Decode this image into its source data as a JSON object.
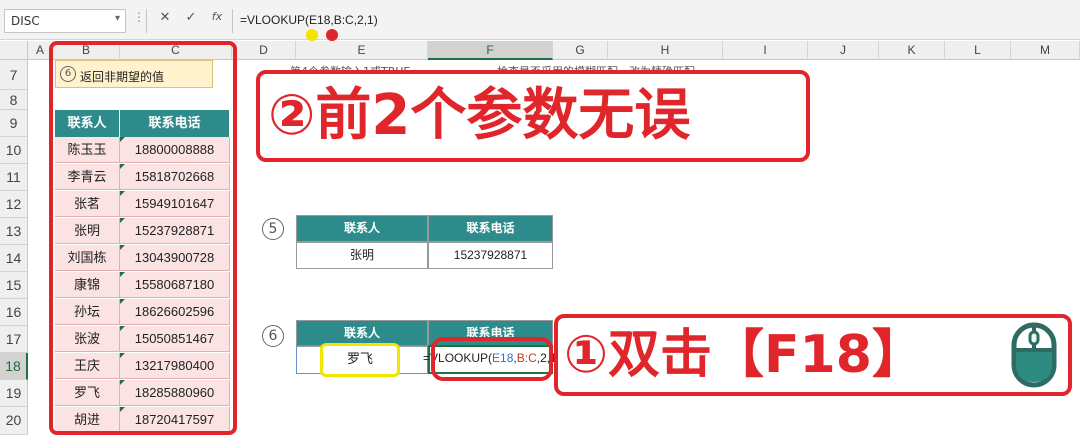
{
  "formula_bar": {
    "name_box": "DISC",
    "cancel_icon": "✕",
    "enter_icon": "✓",
    "function_icon": "fx",
    "formula": "=VLOOKUP(E18,B:C,2,1)"
  },
  "columns": [
    "A",
    "B",
    "C",
    "D",
    "E",
    "F",
    "G",
    "H",
    "I",
    "J",
    "K",
    "L",
    "M"
  ],
  "rows": [
    "7",
    "8",
    "9",
    "10",
    "11",
    "12",
    "13",
    "14",
    "15",
    "16",
    "17",
    "18",
    "19",
    "20"
  ],
  "note_row7": {
    "number": "6",
    "text": "返回非期望的值"
  },
  "left_table": {
    "headers": [
      "联系人",
      "联系电话"
    ],
    "rows": [
      [
        "陈玉玉",
        "18800008888"
      ],
      [
        "李青云",
        "15818702668"
      ],
      [
        "张茗",
        "15949101647"
      ],
      [
        "张明",
        "15237928871"
      ],
      [
        "刘国栋",
        "13043900728"
      ],
      [
        "康锦",
        "15580687180"
      ],
      [
        "孙坛",
        "18626602596"
      ],
      [
        "张波",
        "15050851467"
      ],
      [
        "王庆",
        "13217980400"
      ],
      [
        "罗飞",
        "18285880960"
      ],
      [
        "胡进",
        "18720417597"
      ]
    ]
  },
  "faded_text": {
    "e7": "第4个参数输入1或TRUE",
    "g7": "检查是否采用的模糊匹配，改为精确匹配"
  },
  "table5": {
    "number": "5",
    "headers": [
      "联系人",
      "联系电话"
    ],
    "values": [
      "张明",
      "15237928871"
    ]
  },
  "table6": {
    "number": "6",
    "headers": [
      "联系人",
      "联系电话"
    ],
    "name": "罗飞",
    "formula_prefix": "=V",
    "formula_mid": "LOOKUP(",
    "formula_ref1": "E18",
    "formula_comma": ",",
    "formula_ref2": "B:C",
    "formula_rest": ",2,1"
  },
  "callouts": {
    "top": "②前2个参数无误",
    "bottom": "①双击【F18】"
  },
  "icons": {
    "mouse": "mouse-icon"
  },
  "colors": {
    "accent_red": "#e0262a",
    "header_teal": "#2e8b8b",
    "highlight_yellow": "#f2e500",
    "ref_blue": "#2f6fd1",
    "ref_red": "#c0392b"
  }
}
